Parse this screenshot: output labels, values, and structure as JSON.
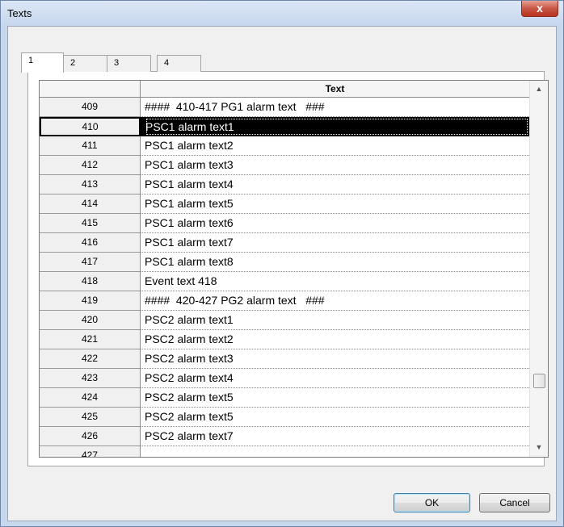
{
  "window": {
    "title": "Texts",
    "close_label": "x"
  },
  "tabs": [
    {
      "label": "1",
      "active": true
    },
    {
      "label": "2",
      "active": false
    },
    {
      "label": "3",
      "active": false
    },
    {
      "label": "4",
      "active": false
    }
  ],
  "grid": {
    "column_header": "Text",
    "rows": [
      {
        "num": "409",
        "text": "####  410-417 PG1 alarm text   ###"
      },
      {
        "num": "410",
        "text": "PSC1 alarm text1",
        "selected": true
      },
      {
        "num": "411",
        "text": "PSC1 alarm text2"
      },
      {
        "num": "412",
        "text": "PSC1 alarm text3"
      },
      {
        "num": "413",
        "text": "PSC1 alarm text4"
      },
      {
        "num": "414",
        "text": "PSC1 alarm text5"
      },
      {
        "num": "415",
        "text": "PSC1 alarm text6"
      },
      {
        "num": "416",
        "text": "PSC1 alarm text7"
      },
      {
        "num": "417",
        "text": "PSC1 alarm text8"
      },
      {
        "num": "418",
        "text": "Event text 418"
      },
      {
        "num": "419",
        "text": "####  420-427 PG2 alarm text   ###"
      },
      {
        "num": "420",
        "text": "PSC2 alarm text1"
      },
      {
        "num": "421",
        "text": "PSC2 alarm text2"
      },
      {
        "num": "422",
        "text": "PSC2 alarm text3"
      },
      {
        "num": "423",
        "text": "PSC2 alarm text4"
      },
      {
        "num": "424",
        "text": "PSC2 alarm text5"
      },
      {
        "num": "425",
        "text": "PSC2 alarm text5"
      },
      {
        "num": "426",
        "text": "PSC2 alarm text7"
      },
      {
        "num": "427",
        "text": ""
      }
    ]
  },
  "buttons": {
    "ok": "OK",
    "cancel": "Cancel"
  },
  "icons": {
    "close": "close-icon",
    "scroll_up": "scroll-up-arrow-icon",
    "scroll_down": "scroll-down-arrow-icon"
  },
  "colors": {
    "titlebar": "#c8d8ec",
    "close_button": "#c75646",
    "selection": "#000000",
    "client": "#f0f0f0"
  }
}
